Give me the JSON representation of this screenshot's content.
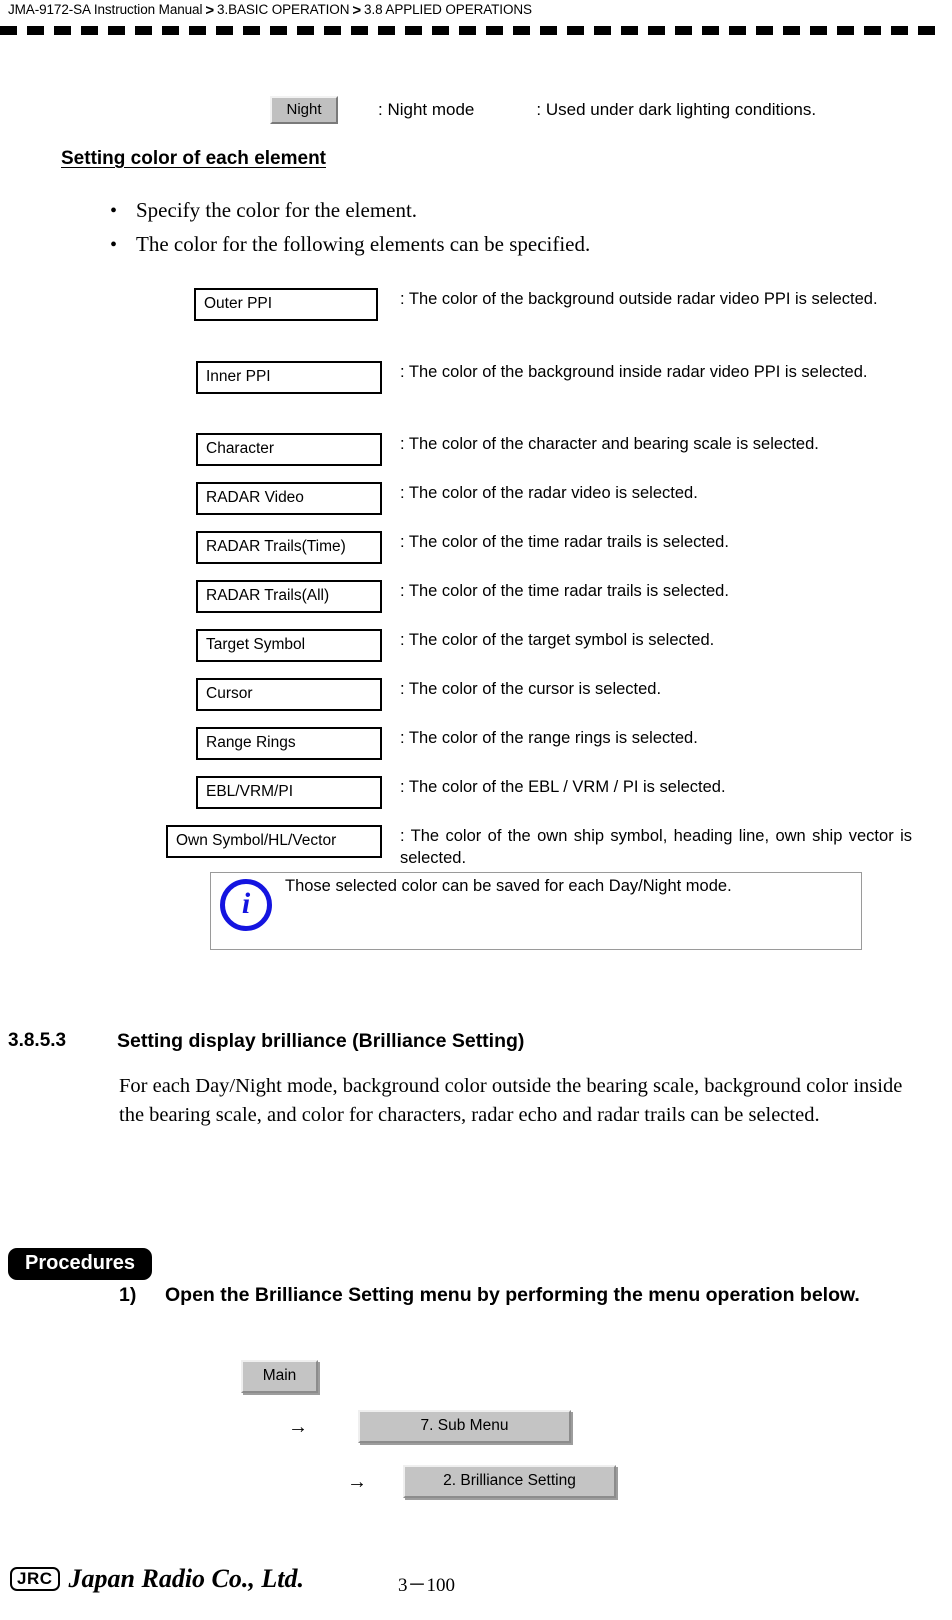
{
  "header": {
    "manual": "JMA-9172-SA Instruction Manual",
    "sep": ">",
    "chapter": "3.BASIC OPERATION",
    "section": "3.8  APPLIED OPERATIONS"
  },
  "legend": {
    "button_label": "Night",
    "mode_text": ": Night mode",
    "description": ": Used under dark lighting conditions."
  },
  "sub_heading": "Setting color of each element",
  "bullets": [
    {
      "marker": "•",
      "text": "Specify the color for the element."
    },
    {
      "marker": "•",
      "text": "The color for the following elements can be specified."
    }
  ],
  "elements": [
    {
      "label": "Outer PPI",
      "desc": ": The color of the background outside radar video PPI is selected."
    },
    {
      "label": "Inner PPI",
      "desc": ": The color of the background inside radar video PPI is selected."
    },
    {
      "label": "Character",
      "desc": ": The color of the character and bearing scale is selected."
    },
    {
      "label": "RADAR Video",
      "desc": ": The color of the radar video is selected."
    },
    {
      "label": "RADAR Trails(Time)",
      "desc": ": The color of the time radar trails is selected."
    },
    {
      "label": "RADAR Trails(All)",
      "desc": ": The color of the time radar trails is selected."
    },
    {
      "label": "Target Symbol",
      "desc": ": The color of the target symbol is selected."
    },
    {
      "label": "Cursor",
      "desc": ": The color of the cursor is selected."
    },
    {
      "label": "Range Rings",
      "desc": ": The color of the range rings is selected."
    },
    {
      "label": "EBL/VRM/PI",
      "desc": ": The color of the EBL / VRM / PI is selected."
    },
    {
      "label": "Own Symbol/HL/Vector",
      "desc": ": The color of the own ship symbol, heading line, own ship vector is selected."
    }
  ],
  "note": {
    "icon": "i",
    "text": "Those selected color can be saved for each Day/Night mode.",
    "icon_color": "#1414e0"
  },
  "section": {
    "number": "3.8.5.3",
    "title": "Setting display brilliance (Brilliance Setting)",
    "body": "For each Day/Night mode, background color outside the bearing scale, background color inside the bearing scale, and color for characters, radar echo and radar trails can be selected."
  },
  "procedures": {
    "badge": "Procedures",
    "step_index": "1)",
    "step_text": "Open the Brilliance Setting menu by performing the menu operation below.",
    "menu_path": [
      {
        "label": "Main"
      },
      {
        "arrow": "→",
        "label": "7. Sub Menu"
      },
      {
        "arrow": "→",
        "label": "2. Brilliance Setting"
      }
    ]
  },
  "footer": {
    "logo_mark": "JRC",
    "company": "Japan Radio Co., Ltd.",
    "page_number": "3－100"
  }
}
